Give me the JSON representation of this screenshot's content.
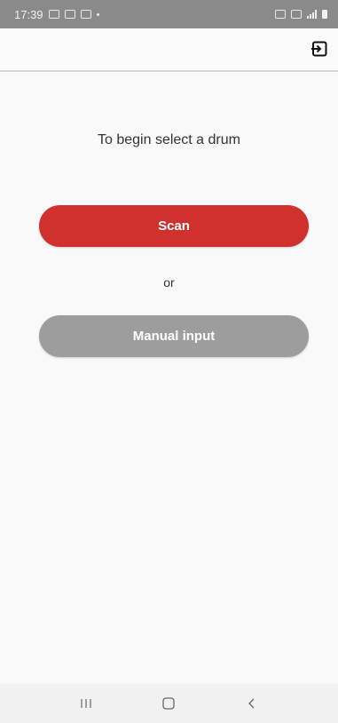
{
  "status_bar": {
    "time": "17:39"
  },
  "colors": {
    "scan_button": "#d0312d",
    "manual_button": "#9d9d9d",
    "status_bar": "#8a8a8a",
    "background": "#f9f9f9"
  },
  "app_bar": {
    "action_icon": "logout-icon"
  },
  "main": {
    "prompt": "To begin select a drum",
    "scan_label": "Scan",
    "or_label": "or",
    "manual_label": "Manual input"
  },
  "nav_bar": {
    "recent_icon": "recent-apps-icon",
    "home_icon": "home-icon",
    "back_icon": "back-icon"
  }
}
